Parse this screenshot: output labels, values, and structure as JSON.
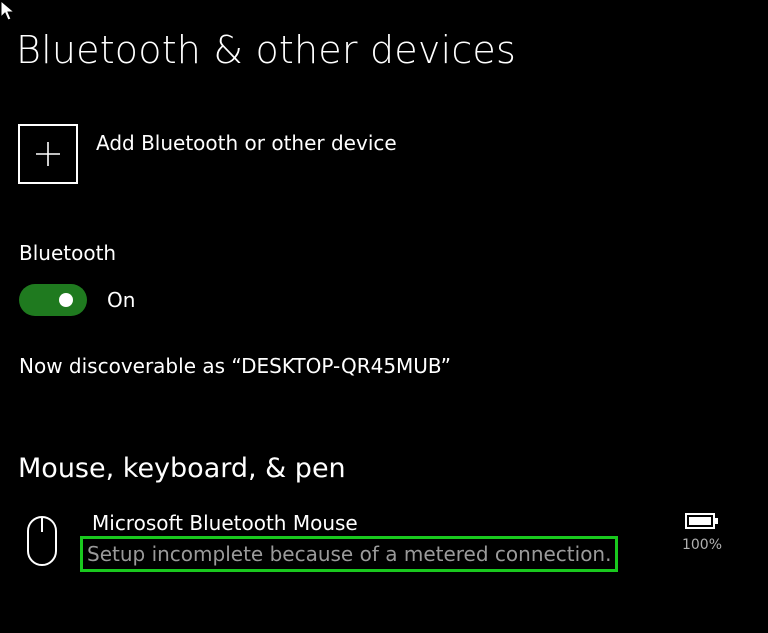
{
  "page": {
    "title": "Bluetooth & other devices"
  },
  "add_device": {
    "label": "Add Bluetooth or other device",
    "icon": "plus-icon"
  },
  "bluetooth": {
    "label": "Bluetooth",
    "state": "On",
    "enabled": true,
    "discoverable_text": "Now discoverable as “DESKTOP-QR45MUB”",
    "accent_color": "#1f7a1f"
  },
  "sections": {
    "mouse_keyboard_pen": {
      "heading": "Mouse, keyboard, & pen",
      "devices": [
        {
          "name": "Microsoft Bluetooth Mouse",
          "status": "Setup incomplete because of a metered connection.",
          "battery": "100%",
          "icon": "mouse-icon",
          "battery_icon": "battery-full-icon",
          "highlight_color": "#19c91e"
        }
      ]
    }
  }
}
